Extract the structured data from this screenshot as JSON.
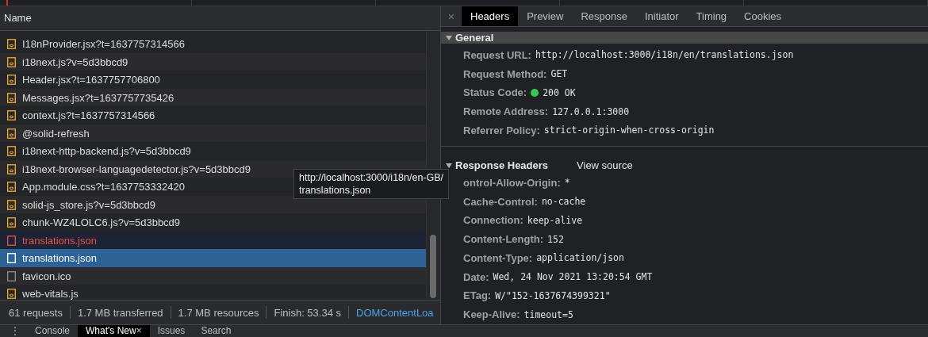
{
  "requests": {
    "column_header": "Name",
    "rows": [
      {
        "name": "I18nProvider.jsx?t=1637757314566",
        "kind": "script",
        "failed": false,
        "hovered": false,
        "selected": false
      },
      {
        "name": "i18next.js?v=5d3bbcd9",
        "kind": "script",
        "failed": false,
        "hovered": false,
        "selected": false
      },
      {
        "name": "Header.jsx?t=1637757706800",
        "kind": "script",
        "failed": false,
        "hovered": false,
        "selected": false
      },
      {
        "name": "Messages.jsx?t=1637757735426",
        "kind": "script",
        "failed": false,
        "hovered": false,
        "selected": false
      },
      {
        "name": "context.js?t=1637757314566",
        "kind": "script",
        "failed": false,
        "hovered": false,
        "selected": false
      },
      {
        "name": "@solid-refresh",
        "kind": "script",
        "failed": false,
        "hovered": false,
        "selected": false
      },
      {
        "name": "i18next-http-backend.js?v=5d3bbcd9",
        "kind": "script",
        "failed": false,
        "hovered": false,
        "selected": false
      },
      {
        "name": "i18next-browser-languagedetector.js?v=5d3bbcd9",
        "kind": "script",
        "failed": false,
        "hovered": false,
        "selected": false
      },
      {
        "name": "App.module.css?t=1637753332420",
        "kind": "script",
        "failed": false,
        "hovered": false,
        "selected": false
      },
      {
        "name": "solid-js_store.js?v=5d3bbcd9",
        "kind": "script",
        "failed": false,
        "hovered": false,
        "selected": false
      },
      {
        "name": "chunk-WZ4LOLC6.js?v=5d3bbcd9",
        "kind": "script",
        "failed": false,
        "hovered": false,
        "selected": false
      },
      {
        "name": "translations.json",
        "kind": "document",
        "failed": true,
        "hovered": true,
        "selected": false
      },
      {
        "name": "translations.json",
        "kind": "document",
        "failed": false,
        "hovered": false,
        "selected": true
      },
      {
        "name": "favicon.ico",
        "kind": "document",
        "failed": false,
        "hovered": false,
        "selected": false
      },
      {
        "name": "web-vitals.js",
        "kind": "script",
        "failed": false,
        "hovered": false,
        "selected": false
      }
    ]
  },
  "tooltip": {
    "lines": [
      "http://localhost:3000/i18n/en-GB/",
      "translations.json"
    ]
  },
  "status_bar": [
    {
      "text": "61 requests",
      "kind": "text"
    },
    {
      "text": "1.7 MB transferred",
      "kind": "text"
    },
    {
      "text": "1.7 MB resources",
      "kind": "text"
    },
    {
      "text": "Finish: 53.34 s",
      "kind": "text"
    },
    {
      "text": "DOMContentLoa",
      "kind": "link"
    }
  ],
  "drawer_tabs": [
    {
      "label": "Console",
      "selected": false,
      "closable": false
    },
    {
      "label": "What's New",
      "selected": true,
      "closable": true
    },
    {
      "label": "Issues",
      "selected": false,
      "closable": false
    },
    {
      "label": "Search",
      "selected": false,
      "closable": false
    }
  ],
  "close_glyph": "×",
  "more_glyph": "⋮",
  "detail_tabs": [
    {
      "label": "Headers",
      "selected": true
    },
    {
      "label": "Preview",
      "selected": false
    },
    {
      "label": "Response",
      "selected": false
    },
    {
      "label": "Initiator",
      "selected": false
    },
    {
      "label": "Timing",
      "selected": false
    },
    {
      "label": "Cookies",
      "selected": false
    }
  ],
  "sections": [
    {
      "title": "General",
      "expanded": true,
      "fields": [
        {
          "label": "Request URL:",
          "value": "http://localhost:3000/i18n/en/translations.json"
        },
        {
          "label": "Request Method:",
          "value": "GET"
        },
        {
          "label": "Status Code:",
          "value": "200 OK",
          "color": "#34c759"
        },
        {
          "label": "Remote Address:",
          "value": "127.0.0.1:3000"
        },
        {
          "label": "Referrer Policy:",
          "value": "strict-origin-when-cross-origin"
        }
      ]
    },
    {
      "title": "Response Headers",
      "expanded": true,
      "action": "View source",
      "fields": [
        {
          "label": "ontrol-Allow-Origin:",
          "value": "*"
        },
        {
          "label": "Cache-Control:",
          "value": "no-cache"
        },
        {
          "label": "Connection:",
          "value": "keep-alive"
        },
        {
          "label": "Content-Length:",
          "value": "152"
        },
        {
          "label": "Content-Type:",
          "value": "application/json"
        },
        {
          "label": "Date:",
          "value": "Wed, 24 Nov 2021 13:20:54 GMT"
        },
        {
          "label": "ETag:",
          "value": "W/\"152-1637674399321\""
        },
        {
          "label": "Keep-Alive:",
          "value": "timeout=5"
        }
      ]
    }
  ]
}
